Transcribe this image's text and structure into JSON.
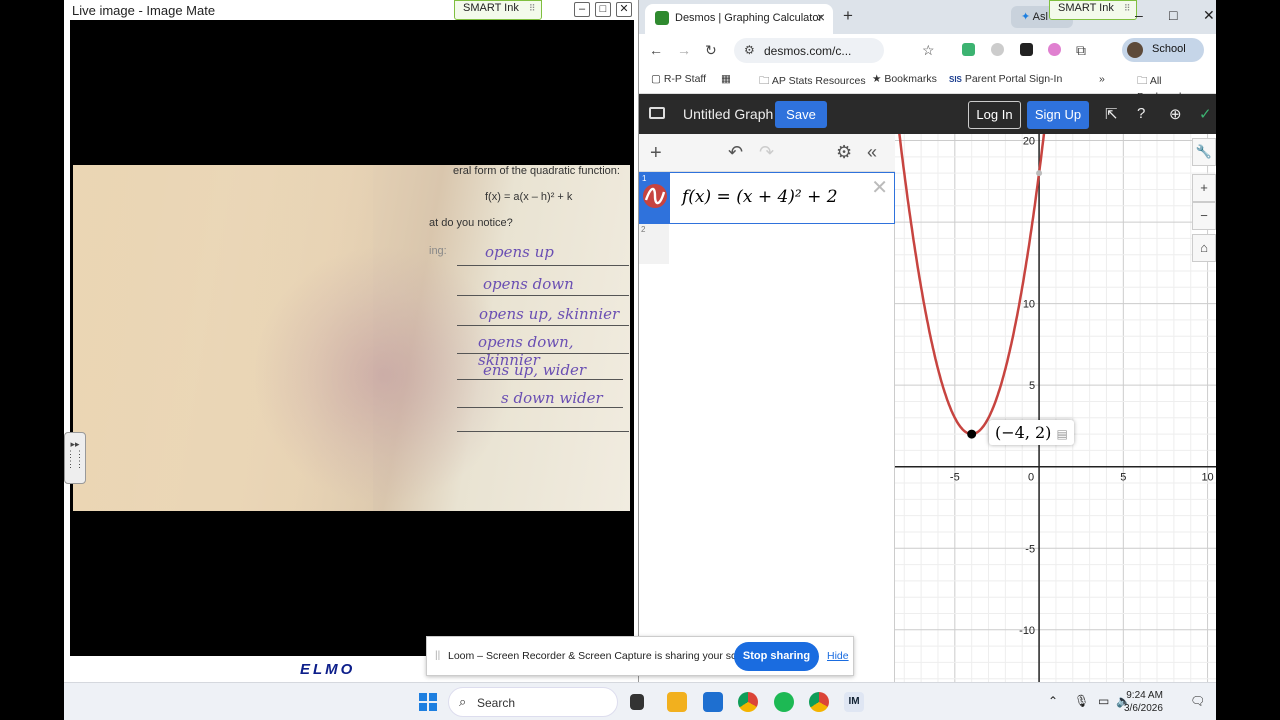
{
  "image_mate": {
    "title": "Live image - Image Mate",
    "smart_ink": "SMART Ink",
    "paper": {
      "heading": "eral form of the quadratic function:",
      "formula": "f(x) = a(x – h)² + k",
      "question": "at do you notice?",
      "prompt": "ing:",
      "answers": [
        "opens up",
        "opens down",
        "opens up, skinnier",
        "opens down, skinnier",
        "ens up, wider",
        "s down wider"
      ]
    },
    "brand": "ELMO"
  },
  "chrome": {
    "tab_title": "Desmos | Graphing Calculator",
    "other_tab": "Asl",
    "smart_ink": "SMART Ink",
    "url": "desmos.com/c...",
    "profile": "School",
    "bookmarks": [
      "R-P Staff",
      "AP Stats Resources",
      "Bookmarks",
      "Parent Portal Sign-In"
    ],
    "all_bookmarks": "All Bookmarks"
  },
  "desmos": {
    "graph_title": "Untitled Graph",
    "save": "Save",
    "login": "Log In",
    "signup": "Sign Up",
    "expression_1_number": "1",
    "expression_2_number": "2",
    "expression_1": "f(x) = (x + 4)² + 2",
    "point_label": "(−4, 2)",
    "curve_color": "#c74440",
    "x_ticks": [
      "-5",
      "0",
      "5",
      "10"
    ],
    "y_ticks": [
      "20",
      "10",
      "5",
      "-5",
      "-10"
    ]
  },
  "loom": {
    "message": "Loom – Screen Recorder & Screen Capture is sharing your screen.",
    "stop": "Stop sharing",
    "hide": "Hide"
  },
  "taskbar": {
    "search": "Search",
    "time": "9:24 AM",
    "date": "3/6/2026",
    "im_label": "IM"
  }
}
